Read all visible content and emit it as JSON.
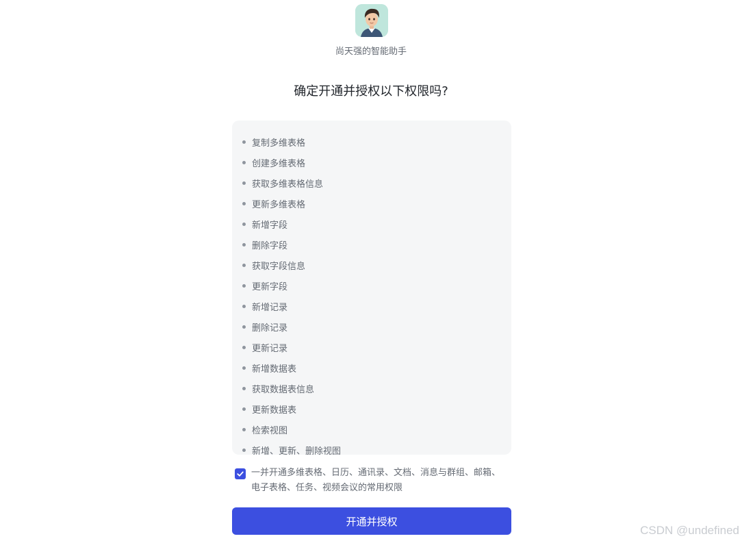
{
  "header": {
    "avatar_icon": "person-avatar-icon",
    "app_name": "尚天强的智能助手",
    "title": "确定开通并授权以下权限吗?"
  },
  "permissions": [
    "复制多维表格",
    "创建多维表格",
    "获取多维表格信息",
    "更新多维表格",
    "新增字段",
    "删除字段",
    "获取字段信息",
    "更新字段",
    "新增记录",
    "删除记录",
    "更新记录",
    "新增数据表",
    "获取数据表信息",
    "更新数据表",
    "检索视图",
    "新增、更新、删除视图"
  ],
  "consent": {
    "checked": true,
    "text": "一并开通多维表格、日历、通讯录、文档、消息与群组、邮箱、电子表格、任务、视频会议的常用权限"
  },
  "submit_label": "开通并授权",
  "watermark": "CSDN @undefined",
  "colors": {
    "primary": "#3c4fe0",
    "panel_bg": "#f5f6f7",
    "text_secondary": "#646a73"
  }
}
